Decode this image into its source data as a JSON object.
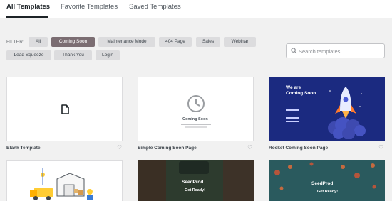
{
  "tabs": [
    {
      "label": "All Templates",
      "active": true
    },
    {
      "label": "Favorite Templates",
      "active": false
    },
    {
      "label": "Saved Templates",
      "active": false
    }
  ],
  "filter": {
    "label": "FILTER:",
    "chips": [
      {
        "label": "All",
        "active": false
      },
      {
        "label": "Coming Soon",
        "active": true
      },
      {
        "label": "Maintenance Mode",
        "active": false
      },
      {
        "label": "404 Page",
        "active": false
      },
      {
        "label": "Sales",
        "active": false
      },
      {
        "label": "Webinar",
        "active": false
      },
      {
        "label": "Lead Squeeze",
        "active": false
      },
      {
        "label": "Thank You",
        "active": false
      },
      {
        "label": "Login",
        "active": false
      }
    ]
  },
  "search": {
    "placeholder": "Search templates..."
  },
  "cards": [
    {
      "title": "Blank Template"
    },
    {
      "title": "Simple Coming Soon Page",
      "preview_text": "Coming Soon"
    },
    {
      "title": "Rocket Coming Soon Page",
      "preview_heading_line1": "We are",
      "preview_heading_line2": "Coming Soon"
    },
    {
      "title": ""
    },
    {
      "title": "",
      "preview_logo": "SeedProd",
      "preview_text": "Get Ready!"
    },
    {
      "title": "",
      "preview_logo": "SeedProd",
      "preview_text": "Get Ready!"
    }
  ],
  "colors": {
    "active_chip": "#7b6d72",
    "rocket_bg": "#1b2a80",
    "accent_orange": "#ff7a2d"
  }
}
